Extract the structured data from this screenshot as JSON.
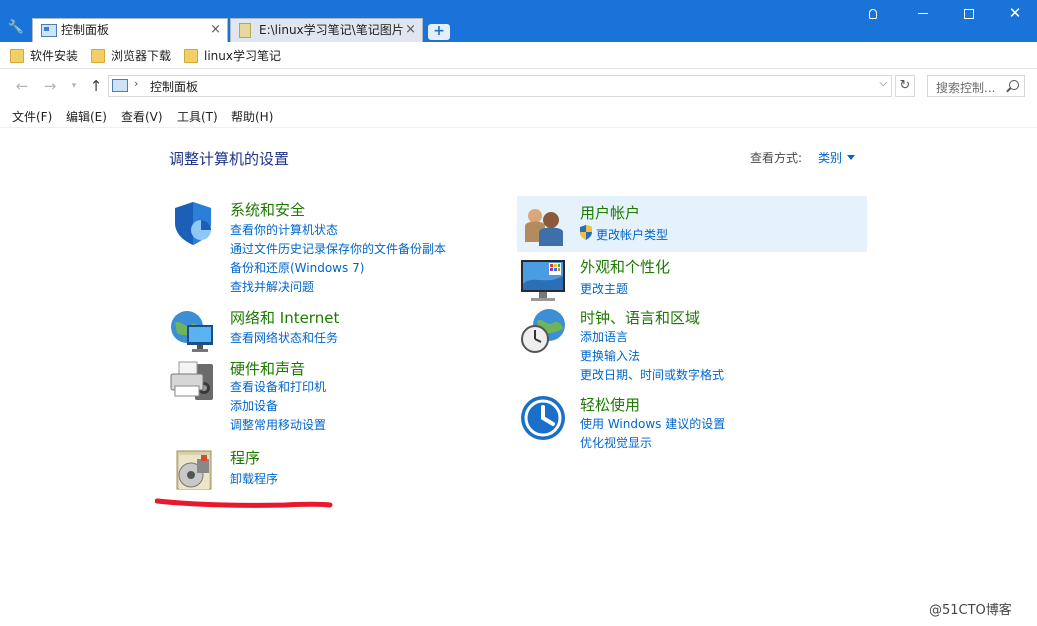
{
  "tabs": [
    {
      "label": "控制面板",
      "close": "×"
    },
    {
      "label": "E:\\linux学习笔记\\笔记图片",
      "close": "×"
    }
  ],
  "new_tab": "+",
  "bookmarks": [
    "软件安装",
    "浏览器下载",
    "linux学习笔记"
  ],
  "address": {
    "path": "控制面板",
    "separator": "›"
  },
  "search": {
    "placeholder": "搜索控制..."
  },
  "menu": [
    "文件(F)",
    "编辑(E)",
    "查看(V)",
    "工具(T)",
    "帮助(H)"
  ],
  "page": {
    "title": "调整计算机的设置",
    "view_by_label": "查看方式:",
    "view_by_value": "类别"
  },
  "categories": {
    "system": {
      "title": "系统和安全",
      "links": [
        "查看你的计算机状态",
        "通过文件历史记录保存你的文件备份副本",
        "备份和还原(Windows 7)",
        "查找并解决问题"
      ]
    },
    "network": {
      "title": "网络和 Internet",
      "links": [
        "查看网络状态和任务"
      ]
    },
    "hardware": {
      "title": "硬件和声音",
      "links": [
        "查看设备和打印机",
        "添加设备",
        "调整常用移动设置"
      ]
    },
    "programs": {
      "title": "程序",
      "links": [
        "卸载程序"
      ]
    },
    "users": {
      "title": "用户帐户",
      "links": [
        "更改帐户类型"
      ]
    },
    "appearance": {
      "title": "外观和个性化",
      "links": [
        "更改主题"
      ]
    },
    "clock": {
      "title": "时钟、语言和区域",
      "links": [
        "添加语言",
        "更换输入法",
        "更改日期、时间或数字格式"
      ]
    },
    "ease": {
      "title": "轻松使用",
      "links": [
        "使用 Windows 建议的设置",
        "优化视觉显示"
      ]
    }
  },
  "watermark": "@51CTO博客",
  "colors": {
    "titlebar": "#1a73d9",
    "category_title": "#1d7a00",
    "link": "#0066cc",
    "heading": "#1e3287",
    "highlight": "#e5f1fb",
    "annotation": "#e8192c"
  }
}
